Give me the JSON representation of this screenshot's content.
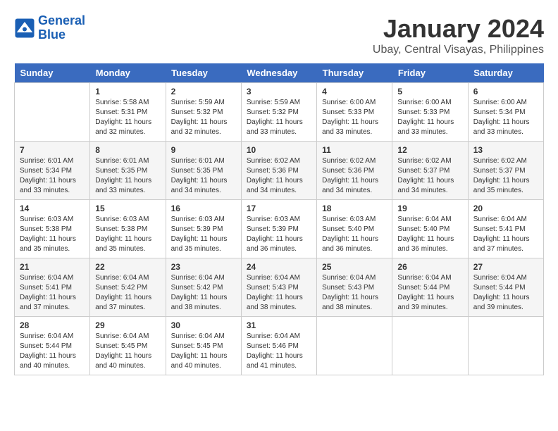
{
  "header": {
    "logo_line1": "General",
    "logo_line2": "Blue",
    "month_title": "January 2024",
    "location": "Ubay, Central Visayas, Philippines"
  },
  "days_of_week": [
    "Sunday",
    "Monday",
    "Tuesday",
    "Wednesday",
    "Thursday",
    "Friday",
    "Saturday"
  ],
  "weeks": [
    [
      {
        "num": "",
        "sunrise": "",
        "sunset": "",
        "daylight": ""
      },
      {
        "num": "1",
        "sunrise": "Sunrise: 5:58 AM",
        "sunset": "Sunset: 5:31 PM",
        "daylight": "Daylight: 11 hours and 32 minutes."
      },
      {
        "num": "2",
        "sunrise": "Sunrise: 5:59 AM",
        "sunset": "Sunset: 5:32 PM",
        "daylight": "Daylight: 11 hours and 32 minutes."
      },
      {
        "num": "3",
        "sunrise": "Sunrise: 5:59 AM",
        "sunset": "Sunset: 5:32 PM",
        "daylight": "Daylight: 11 hours and 33 minutes."
      },
      {
        "num": "4",
        "sunrise": "Sunrise: 6:00 AM",
        "sunset": "Sunset: 5:33 PM",
        "daylight": "Daylight: 11 hours and 33 minutes."
      },
      {
        "num": "5",
        "sunrise": "Sunrise: 6:00 AM",
        "sunset": "Sunset: 5:33 PM",
        "daylight": "Daylight: 11 hours and 33 minutes."
      },
      {
        "num": "6",
        "sunrise": "Sunrise: 6:00 AM",
        "sunset": "Sunset: 5:34 PM",
        "daylight": "Daylight: 11 hours and 33 minutes."
      }
    ],
    [
      {
        "num": "7",
        "sunrise": "Sunrise: 6:01 AM",
        "sunset": "Sunset: 5:34 PM",
        "daylight": "Daylight: 11 hours and 33 minutes."
      },
      {
        "num": "8",
        "sunrise": "Sunrise: 6:01 AM",
        "sunset": "Sunset: 5:35 PM",
        "daylight": "Daylight: 11 hours and 33 minutes."
      },
      {
        "num": "9",
        "sunrise": "Sunrise: 6:01 AM",
        "sunset": "Sunset: 5:35 PM",
        "daylight": "Daylight: 11 hours and 34 minutes."
      },
      {
        "num": "10",
        "sunrise": "Sunrise: 6:02 AM",
        "sunset": "Sunset: 5:36 PM",
        "daylight": "Daylight: 11 hours and 34 minutes."
      },
      {
        "num": "11",
        "sunrise": "Sunrise: 6:02 AM",
        "sunset": "Sunset: 5:36 PM",
        "daylight": "Daylight: 11 hours and 34 minutes."
      },
      {
        "num": "12",
        "sunrise": "Sunrise: 6:02 AM",
        "sunset": "Sunset: 5:37 PM",
        "daylight": "Daylight: 11 hours and 34 minutes."
      },
      {
        "num": "13",
        "sunrise": "Sunrise: 6:02 AM",
        "sunset": "Sunset: 5:37 PM",
        "daylight": "Daylight: 11 hours and 35 minutes."
      }
    ],
    [
      {
        "num": "14",
        "sunrise": "Sunrise: 6:03 AM",
        "sunset": "Sunset: 5:38 PM",
        "daylight": "Daylight: 11 hours and 35 minutes."
      },
      {
        "num": "15",
        "sunrise": "Sunrise: 6:03 AM",
        "sunset": "Sunset: 5:38 PM",
        "daylight": "Daylight: 11 hours and 35 minutes."
      },
      {
        "num": "16",
        "sunrise": "Sunrise: 6:03 AM",
        "sunset": "Sunset: 5:39 PM",
        "daylight": "Daylight: 11 hours and 35 minutes."
      },
      {
        "num": "17",
        "sunrise": "Sunrise: 6:03 AM",
        "sunset": "Sunset: 5:39 PM",
        "daylight": "Daylight: 11 hours and 36 minutes."
      },
      {
        "num": "18",
        "sunrise": "Sunrise: 6:03 AM",
        "sunset": "Sunset: 5:40 PM",
        "daylight": "Daylight: 11 hours and 36 minutes."
      },
      {
        "num": "19",
        "sunrise": "Sunrise: 6:04 AM",
        "sunset": "Sunset: 5:40 PM",
        "daylight": "Daylight: 11 hours and 36 minutes."
      },
      {
        "num": "20",
        "sunrise": "Sunrise: 6:04 AM",
        "sunset": "Sunset: 5:41 PM",
        "daylight": "Daylight: 11 hours and 37 minutes."
      }
    ],
    [
      {
        "num": "21",
        "sunrise": "Sunrise: 6:04 AM",
        "sunset": "Sunset: 5:41 PM",
        "daylight": "Daylight: 11 hours and 37 minutes."
      },
      {
        "num": "22",
        "sunrise": "Sunrise: 6:04 AM",
        "sunset": "Sunset: 5:42 PM",
        "daylight": "Daylight: 11 hours and 37 minutes."
      },
      {
        "num": "23",
        "sunrise": "Sunrise: 6:04 AM",
        "sunset": "Sunset: 5:42 PM",
        "daylight": "Daylight: 11 hours and 38 minutes."
      },
      {
        "num": "24",
        "sunrise": "Sunrise: 6:04 AM",
        "sunset": "Sunset: 5:43 PM",
        "daylight": "Daylight: 11 hours and 38 minutes."
      },
      {
        "num": "25",
        "sunrise": "Sunrise: 6:04 AM",
        "sunset": "Sunset: 5:43 PM",
        "daylight": "Daylight: 11 hours and 38 minutes."
      },
      {
        "num": "26",
        "sunrise": "Sunrise: 6:04 AM",
        "sunset": "Sunset: 5:44 PM",
        "daylight": "Daylight: 11 hours and 39 minutes."
      },
      {
        "num": "27",
        "sunrise": "Sunrise: 6:04 AM",
        "sunset": "Sunset: 5:44 PM",
        "daylight": "Daylight: 11 hours and 39 minutes."
      }
    ],
    [
      {
        "num": "28",
        "sunrise": "Sunrise: 6:04 AM",
        "sunset": "Sunset: 5:44 PM",
        "daylight": "Daylight: 11 hours and 40 minutes."
      },
      {
        "num": "29",
        "sunrise": "Sunrise: 6:04 AM",
        "sunset": "Sunset: 5:45 PM",
        "daylight": "Daylight: 11 hours and 40 minutes."
      },
      {
        "num": "30",
        "sunrise": "Sunrise: 6:04 AM",
        "sunset": "Sunset: 5:45 PM",
        "daylight": "Daylight: 11 hours and 40 minutes."
      },
      {
        "num": "31",
        "sunrise": "Sunrise: 6:04 AM",
        "sunset": "Sunset: 5:46 PM",
        "daylight": "Daylight: 11 hours and 41 minutes."
      },
      {
        "num": "",
        "sunrise": "",
        "sunset": "",
        "daylight": ""
      },
      {
        "num": "",
        "sunrise": "",
        "sunset": "",
        "daylight": ""
      },
      {
        "num": "",
        "sunrise": "",
        "sunset": "",
        "daylight": ""
      }
    ]
  ]
}
